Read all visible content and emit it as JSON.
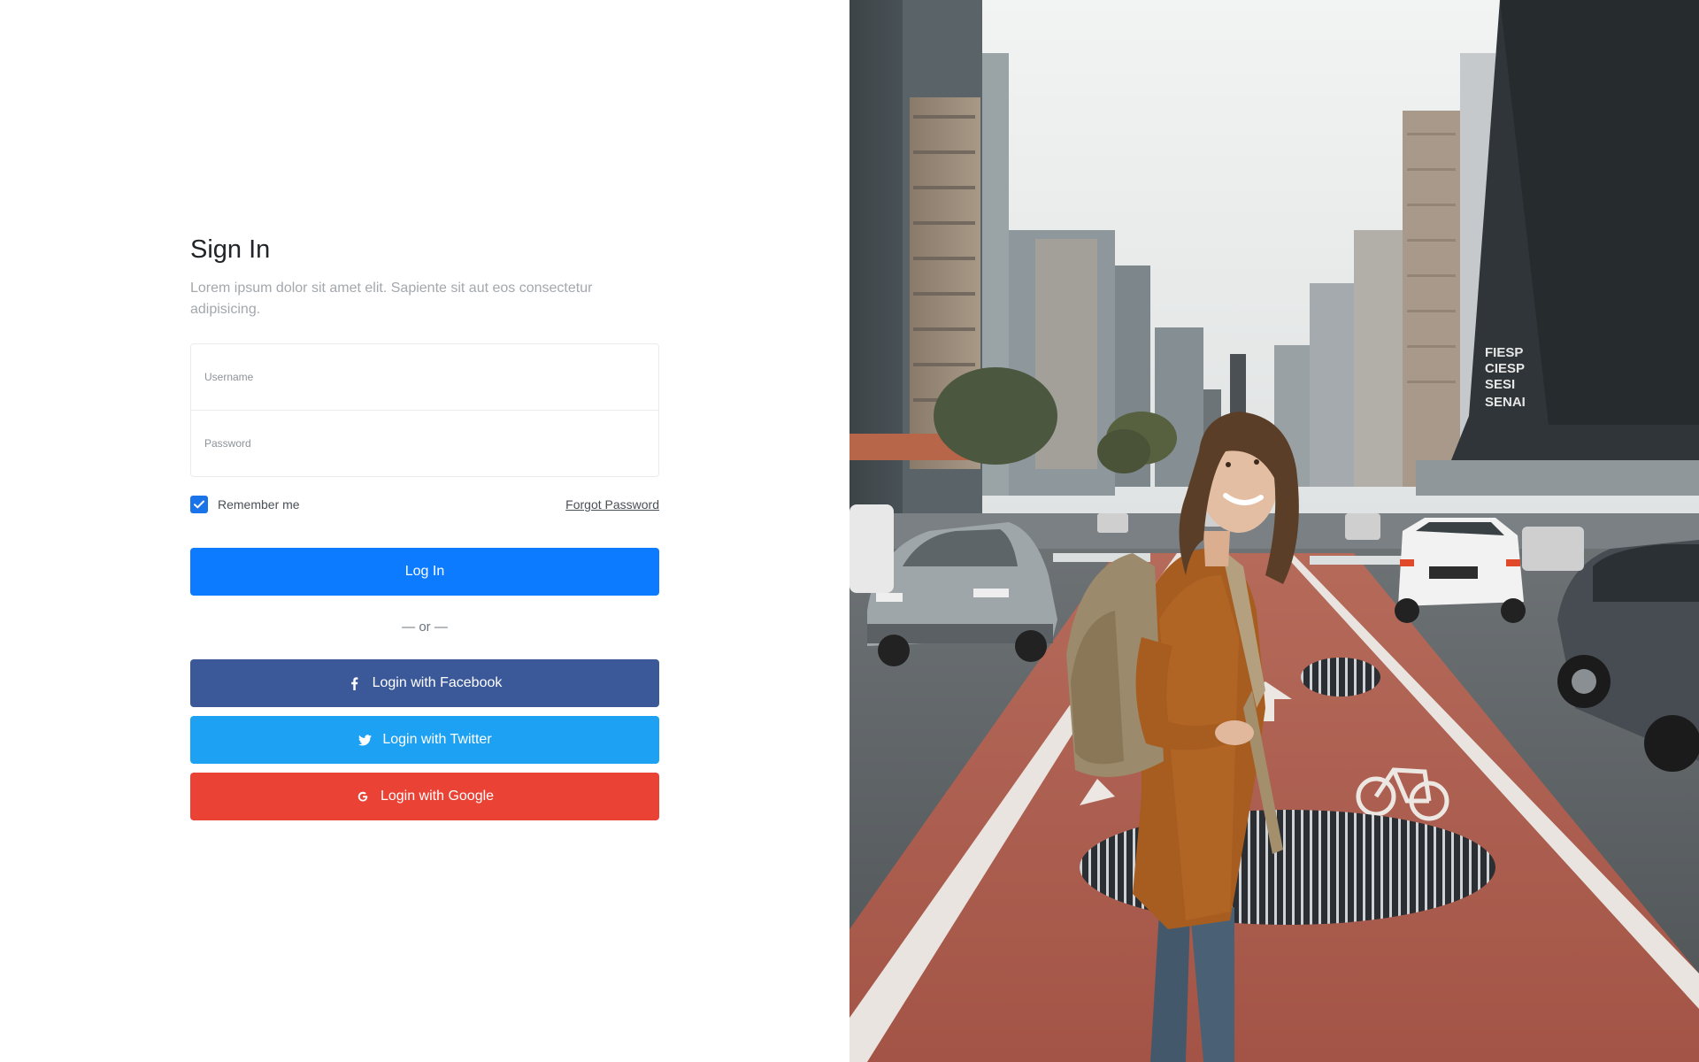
{
  "signin": {
    "title": "Sign In",
    "subtitle": "Lorem ipsum dolor sit amet elit. Sapiente sit aut eos consectetur adipisicing.",
    "username_label": "Username",
    "password_label": "Password",
    "username_value": "",
    "password_value": "",
    "remember_label": "Remember me",
    "remember_checked": true,
    "forgot_label": "Forgot Password",
    "login_label": "Log In",
    "or_label": "— or —",
    "facebook_label": "Login with Facebook",
    "twitter_label": "Login with Twitter",
    "google_label": "Login with Google"
  },
  "hero": {
    "sign_text_lines": [
      "FIESP",
      "CIESP",
      "SESI",
      "SENAI"
    ]
  },
  "colors": {
    "primary": "#0d7bff",
    "facebook": "#3b5998",
    "twitter": "#1da1f2",
    "google": "#ea4335",
    "checkbox": "#1a73e8"
  },
  "icons": {
    "facebook": "facebook-icon",
    "twitter": "twitter-icon",
    "google": "google-icon",
    "check": "check-icon"
  }
}
